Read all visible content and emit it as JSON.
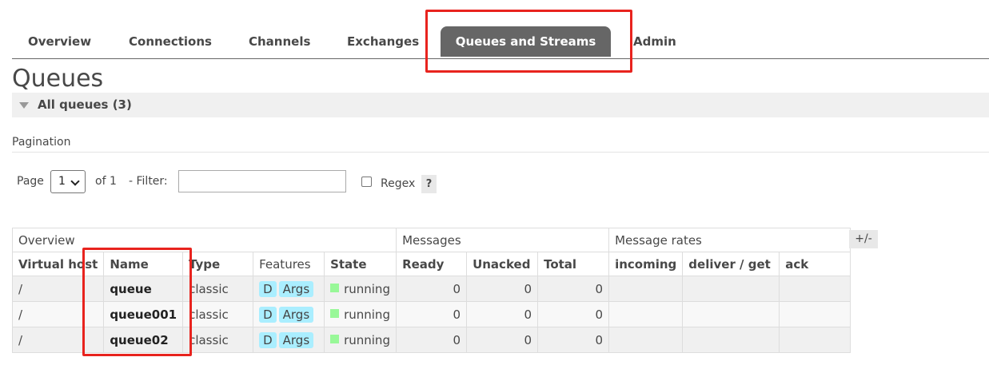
{
  "tabs": [
    {
      "label": "Overview"
    },
    {
      "label": "Connections"
    },
    {
      "label": "Channels"
    },
    {
      "label": "Exchanges"
    },
    {
      "label": "Queues and Streams",
      "active": true
    },
    {
      "label": "Admin"
    }
  ],
  "page_title": "Queues",
  "section": {
    "label": "All queues (3)"
  },
  "pagination": {
    "label": "Pagination",
    "page_label": "Page",
    "page_value": "1",
    "of_label": "of 1",
    "filter_label": "- Filter:",
    "filter_value": "",
    "regex_label": "Regex",
    "help_label": "?"
  },
  "table": {
    "groups": {
      "overview": "Overview",
      "messages": "Messages",
      "rates": "Message rates"
    },
    "columns": {
      "vhost": "Virtual host",
      "name": "Name",
      "type": "Type",
      "features": "Features",
      "state": "State",
      "ready": "Ready",
      "unacked": "Unacked",
      "total": "Total",
      "incoming": "incoming",
      "deliver": "deliver / get",
      "ack": "ack"
    },
    "rows": [
      {
        "vhost": "/",
        "name": "queue",
        "type": "classic",
        "feat_d": "D",
        "feat_args": "Args",
        "state": "running",
        "ready": "0",
        "unacked": "0",
        "total": "0",
        "incoming": "",
        "deliver": "",
        "ack": ""
      },
      {
        "vhost": "/",
        "name": "queue001",
        "type": "classic",
        "feat_d": "D",
        "feat_args": "Args",
        "state": "running",
        "ready": "0",
        "unacked": "0",
        "total": "0",
        "incoming": "",
        "deliver": "",
        "ack": ""
      },
      {
        "vhost": "/",
        "name": "queue02",
        "type": "classic",
        "feat_d": "D",
        "feat_args": "Args",
        "state": "running",
        "ready": "0",
        "unacked": "0",
        "total": "0",
        "incoming": "",
        "deliver": "",
        "ack": ""
      }
    ],
    "columns_toggle": "+/-"
  },
  "colors": {
    "highlight": "#e8231e",
    "active_tab": "#666666",
    "feature_tag": "#aaeeff",
    "running": "#98f898"
  }
}
